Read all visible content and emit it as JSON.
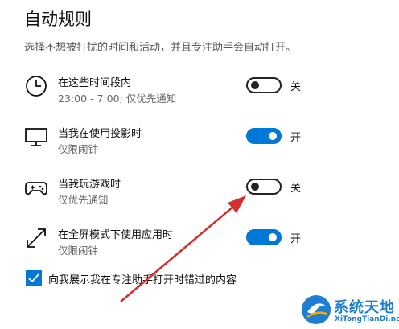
{
  "settings": {
    "title": "自动规则",
    "description": "选择不想被打扰的时间和活动，并且专注助手会自动打开。",
    "rules": [
      {
        "icon": "clock-icon",
        "name": "在这些时间段内",
        "sub": "23:00 - 7:00; 仅优先通知",
        "state": "关",
        "on": false
      },
      {
        "icon": "monitor-icon",
        "name": "当我在使用投影时",
        "sub": "仅限闹钟",
        "state": "开",
        "on": true
      },
      {
        "icon": "gamepad-icon",
        "name": "当我玩游戏时",
        "sub": "仅优先通知",
        "state": "关",
        "on": false
      },
      {
        "icon": "fullscreen-icon",
        "name": "在全屏模式下使用应用时",
        "sub": "仅限闹钟",
        "state": "开",
        "on": true
      }
    ],
    "checkbox": {
      "label": "向我展示我在专注助手打开时错过的内容",
      "checked": true
    }
  },
  "colors": {
    "accent": "#0078d7",
    "annotation": "#d32f2f"
  },
  "watermark": {
    "text": "系统天地",
    "url": "XiTongTianDi.net"
  }
}
